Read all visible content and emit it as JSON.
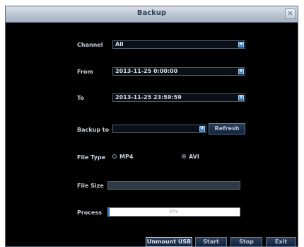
{
  "window": {
    "title": "Backup",
    "close_glyph": "×"
  },
  "channel": {
    "label": "Channel",
    "value": "All"
  },
  "from": {
    "label": "From",
    "value": "2013-11-25 0:00:00"
  },
  "to": {
    "label": "To",
    "value": "2013-11-25 23:59:59"
  },
  "backup_to": {
    "label": "Backup to",
    "value": "",
    "refresh_label": "Refresh"
  },
  "file_type": {
    "label": "File Type",
    "options": [
      "MP4",
      "AVI"
    ],
    "selected": "AVI"
  },
  "file_size": {
    "label": "File Size",
    "value": ""
  },
  "process": {
    "label": "Process",
    "percent_text": "0%",
    "percent": 0
  },
  "buttons": {
    "unmount": "Unmount USB",
    "start": "Start",
    "stop": "Stop",
    "exit": "Exit"
  },
  "icons": {
    "spin": "▾",
    "spin_up_down": "⇕"
  },
  "colors": {
    "accent": "#2d6fb2",
    "background": "#000000",
    "titlebar": "#b9c4d2"
  }
}
